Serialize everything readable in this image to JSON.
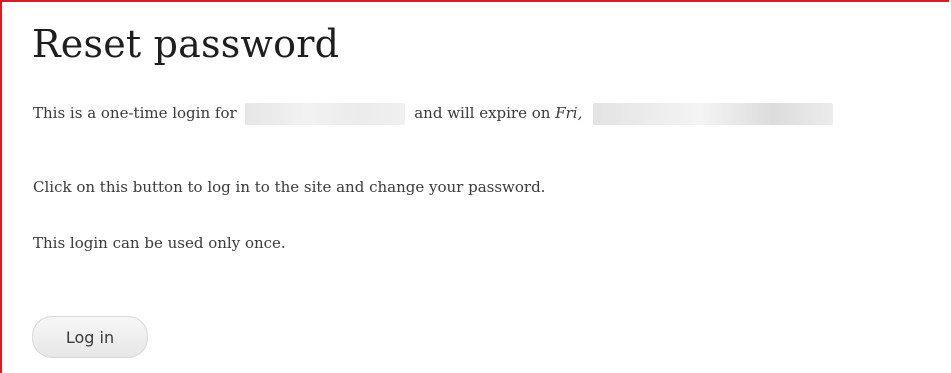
{
  "page": {
    "title": "Reset password",
    "expire_intro_prefix": "This is a one-time login for",
    "expire_intro_middle": "and will expire on",
    "expire_day": "Fri,",
    "instruction": "Click on this button to log in to the site and change your password.",
    "once_notice": "This login can be used only once."
  },
  "form": {
    "login_button": "Log in"
  },
  "colors": {
    "frame_border": "#d21f1f",
    "button_bg": "#efefef",
    "text": "#3a3a3a"
  }
}
